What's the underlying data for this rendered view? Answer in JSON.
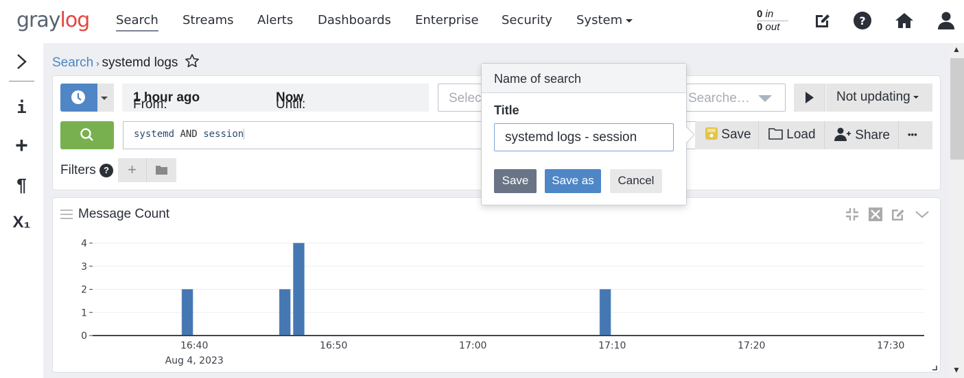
{
  "app": {
    "logo_gray": "gray",
    "logo_red": "log"
  },
  "nav": {
    "items": [
      {
        "label": "Search",
        "active": true
      },
      {
        "label": "Streams"
      },
      {
        "label": "Alerts"
      },
      {
        "label": "Dashboards"
      },
      {
        "label": "Enterprise"
      },
      {
        "label": "Security"
      },
      {
        "label": "System"
      }
    ],
    "throughput": {
      "in_value": "0",
      "in_label": "in",
      "out_value": "0",
      "out_label": "out"
    },
    "icons": [
      "edit-icon",
      "help-icon",
      "home-icon",
      "user-icon"
    ]
  },
  "sidebar": {
    "icons": [
      {
        "name": "expand-chevron-icon",
        "glyph": "›"
      },
      {
        "name": "info-icon",
        "glyph": "i"
      },
      {
        "name": "add-icon",
        "glyph": "+"
      },
      {
        "name": "paragraph-icon",
        "glyph": "¶"
      },
      {
        "name": "subscript-x-icon",
        "glyph": "X₁"
      }
    ]
  },
  "breadcrumb": {
    "root": "Search",
    "separator": "›",
    "current": "systemd logs"
  },
  "search_bar": {
    "from_label": "From:",
    "from_value": "1 hour ago",
    "until_label": "Until:",
    "until_value": "Now",
    "stream_placeholder_left": "Select",
    "stream_placeholder_right": "Searche…",
    "refresh_label": "Not updating",
    "query": {
      "term1": "systemd",
      "op": "AND",
      "term2": "session"
    },
    "actions": {
      "save": "Save",
      "load": "Load",
      "share": "Share",
      "more": "•••"
    },
    "filters_label": "Filters",
    "filters_help": "?"
  },
  "save_popover": {
    "header": "Name of search",
    "title_label": "Title",
    "title_value": "systemd logs - session",
    "save_button": "Save",
    "save_as_button": "Save as",
    "cancel_button": "Cancel"
  },
  "widget": {
    "title": "Message Count"
  },
  "colors": {
    "bar": "#4577b2",
    "primary": "#4f86c6",
    "success": "#79b04f",
    "logo_red": "#e5453f",
    "save_icon": "#e2c548"
  },
  "chart_data": {
    "type": "bar",
    "title": "Message Count",
    "xlabel": "",
    "ylabel": "",
    "x_ticks": [
      "16:40",
      "16:50",
      "17:00",
      "17:10",
      "17:20",
      "17:30"
    ],
    "x_tick_minutes": [
      1000,
      1010,
      1020,
      1030,
      1040,
      1050
    ],
    "x_sublabel": "Aug 4, 2023",
    "xlim_minutes": [
      992.7,
      1052.4
    ],
    "y_ticks": [
      0,
      1,
      2,
      3,
      4
    ],
    "ylim": [
      0,
      4
    ],
    "grid": true,
    "bars": [
      {
        "time": "16:39",
        "minute": 999,
        "value": 2
      },
      {
        "time": "16:46",
        "minute": 1006,
        "value": 2
      },
      {
        "time": "16:47",
        "minute": 1007,
        "value": 4
      },
      {
        "time": "17:09",
        "minute": 1029,
        "value": 2
      }
    ]
  }
}
